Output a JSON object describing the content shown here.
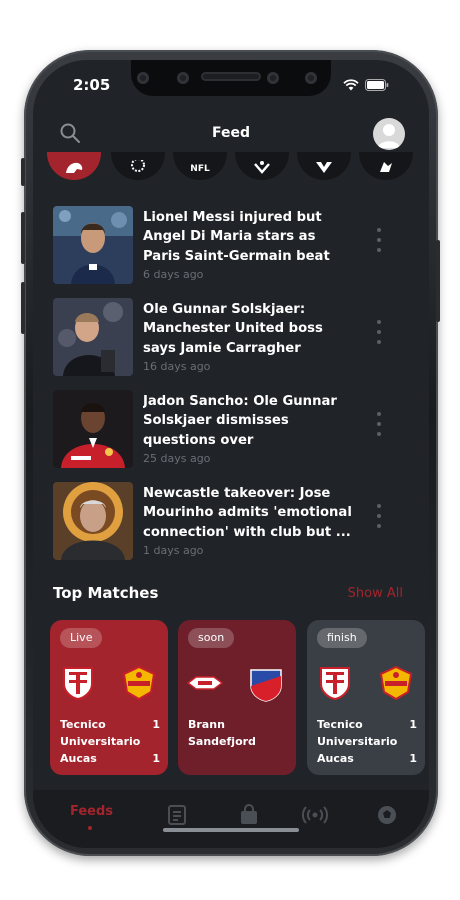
{
  "status_bar": {
    "time": "2:05"
  },
  "header": {
    "title": "Feed"
  },
  "categories": [
    {
      "label": "",
      "icon": "premier-league-icon",
      "active": true
    },
    {
      "label": "",
      "icon": "laliga-icon",
      "active": false
    },
    {
      "label": "NFL",
      "icon": "nfl-icon",
      "active": false
    },
    {
      "label": "",
      "icon": "champions-league-icon",
      "active": false
    },
    {
      "label": "",
      "icon": "mls-icon",
      "active": false
    },
    {
      "label": "",
      "icon": "bundesliga-icon",
      "active": false
    }
  ],
  "news": [
    {
      "title": "Lionel Messi injured but Angel Di Maria stars as Paris Saint-Germain beat Lille - Europe...",
      "time": "6 days ago"
    },
    {
      "title": "Ole Gunnar Solskjaer: Manchester United boss says Jamie Carragher criticisms ...",
      "time": "16 days ago"
    },
    {
      "title": "Jadon Sancho: Ole Gunnar Solskjaer dismisses questions over 'exceptional'...",
      "time": "25 days ago"
    },
    {
      "title": "Newcastle takeover: Jose Mourinho admits 'emotional connection' with club but ...",
      "time": "1 days ago"
    }
  ],
  "top_matches": {
    "title": "Top Matches",
    "show_all": "Show All",
    "cards": [
      {
        "status": "Live",
        "color": "#a3242c",
        "home": "Tecnico Universitario",
        "home_score": "1",
        "away": "Aucas",
        "away_score": "1"
      },
      {
        "status": "soon",
        "color": "#6e1f2a",
        "home": "Brann",
        "home_score": "",
        "away": "Sandefjord",
        "away_score": ""
      },
      {
        "status": "finish",
        "color": "#3a3e45",
        "home": "Tecnico Universitario",
        "home_score": "1",
        "away": "Aucas",
        "away_score": "1"
      }
    ]
  },
  "tabbar": {
    "feeds": "Feeds",
    "icons": [
      "news-icon",
      "bag-icon",
      "live-signal-icon",
      "football-icon"
    ]
  }
}
